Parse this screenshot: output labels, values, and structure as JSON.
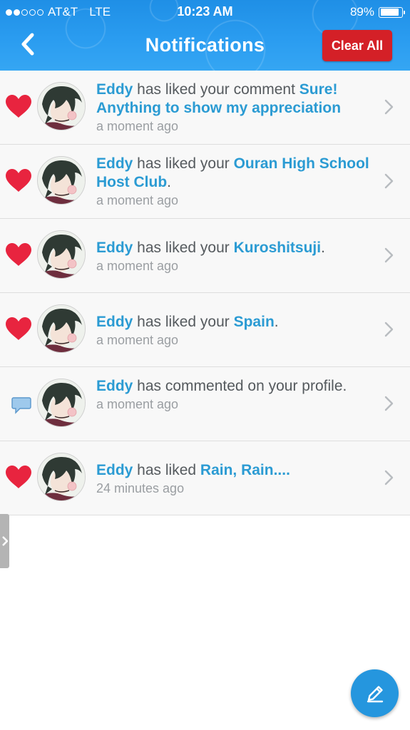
{
  "status_bar": {
    "carrier": "AT&T",
    "network": "LTE",
    "time": "10:23 AM",
    "battery": "89%",
    "battery_level": 0.89
  },
  "nav": {
    "back_icon": "chevron-left-icon",
    "title": "Notifications",
    "clear_label": "Clear All",
    "clear_color": "#d42027",
    "accent_color": "#2b9bd3"
  },
  "notifications": [
    {
      "icon": "heart-icon",
      "name": "Eddy",
      "action": " has liked your comment ",
      "target": "Sure! Anything to show my appreciation",
      "suffix": "",
      "time": "a moment ago"
    },
    {
      "icon": "heart-icon",
      "name": "Eddy",
      "action": " has liked your ",
      "target": "Ouran High School Host Club",
      "suffix": ".",
      "time": "a moment ago"
    },
    {
      "icon": "heart-icon",
      "name": "Eddy",
      "action": " has liked your ",
      "target": "Kuroshitsuji",
      "suffix": ".",
      "time": "a moment ago"
    },
    {
      "icon": "heart-icon",
      "name": "Eddy",
      "action": " has liked your ",
      "target": "Spain",
      "suffix": ".",
      "time": "a moment ago"
    },
    {
      "icon": "comment-bubble-icon",
      "name": "Eddy",
      "action": " has commented on your profile.",
      "target": "",
      "suffix": "",
      "time": "a moment ago"
    },
    {
      "icon": "heart-icon",
      "name": "Eddy",
      "action": " has liked ",
      "target": "Rain, Rain....",
      "suffix": "",
      "time": "24 minutes ago"
    }
  ],
  "fab_icon": "pencil-icon",
  "side_tab_icon": "chevron-right-icon"
}
